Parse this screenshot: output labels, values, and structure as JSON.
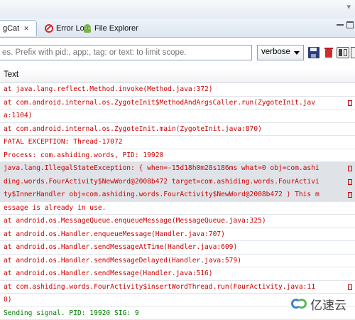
{
  "tabs": [
    {
      "label": "gCat",
      "close": "✕",
      "active": true
    },
    {
      "label": "Error Log",
      "icon": "error-log-icon"
    },
    {
      "label": "File Explorer",
      "icon": "android-icon"
    }
  ],
  "filter": {
    "placeholder": "es. Prefix with pid:, app:, tag: or text: to limit scope.",
    "level": "verbose"
  },
  "columns": {
    "text": "Text"
  },
  "log_lines": [
    {
      "text": "at java.lang.reflect.Method.invoke(Method.java:372)",
      "level": "error",
      "selected": false
    },
    {
      "text": "at com.android.internal.os.ZygoteInit$MethodAndArgsCaller.run(ZygoteInit.jav",
      "level": "error",
      "selected": false,
      "wrap": true
    },
    {
      "text": "a:1104)",
      "level": "error",
      "selected": false
    },
    {
      "text": "at com.android.internal.os.ZygoteInit.main(ZygoteInit.java:870)",
      "level": "error",
      "selected": false
    },
    {
      "text": "FATAL EXCEPTION: Thread-17072",
      "level": "error",
      "selected": false
    },
    {
      "text": "Process: com.ashiding.words, PID: 19920",
      "level": "error",
      "selected": false
    },
    {
      "text": "java.lang.IllegalStateException: { when=-15d18h0m28s186ms what=0 obj=com.ashi",
      "level": "error",
      "selected": true,
      "wrap": true
    },
    {
      "text": "ding.words.FourActivity$NewWord@2008b472 target=com.ashiding.words.FourActivi",
      "level": "error",
      "selected": true,
      "wrap": true
    },
    {
      "text": "ty$InnerHandler obj=com.ashiding.words.FourActivity$NewWord@2008b472 ) This m",
      "level": "error",
      "selected": true,
      "wrap": true
    },
    {
      "text": "essage is already in use.",
      "level": "error",
      "selected": false
    },
    {
      "text": "at android.os.MessageQueue.enqueueMessage(MessageQueue.java:325)",
      "level": "error",
      "selected": false
    },
    {
      "text": "at android.os.Handler.enqueueMessage(Handler.java:707)",
      "level": "error",
      "selected": false
    },
    {
      "text": "at android.os.Handler.sendMessageAtTime(Handler.java:609)",
      "level": "error",
      "selected": false
    },
    {
      "text": "at android.os.Handler.sendMessageDelayed(Handler.java:579)",
      "level": "error",
      "selected": false
    },
    {
      "text": "at android.os.Handler.sendMessage(Handler.java:516)",
      "level": "error",
      "selected": false
    },
    {
      "text": "at com.ashiding.words.FourActivity$insertWordThread.run(FourActivity.java:11",
      "level": "error",
      "selected": false,
      "wrap": true
    },
    {
      "text": "0)",
      "level": "error",
      "selected": false
    },
    {
      "text": "Sending signal. PID: 19920 SIG: 9",
      "level": "info",
      "selected": false
    }
  ],
  "watermark": "亿速云",
  "colors": {
    "error": "#cc0000",
    "info": "#007a00",
    "selected_row": "#dfe3e8"
  }
}
